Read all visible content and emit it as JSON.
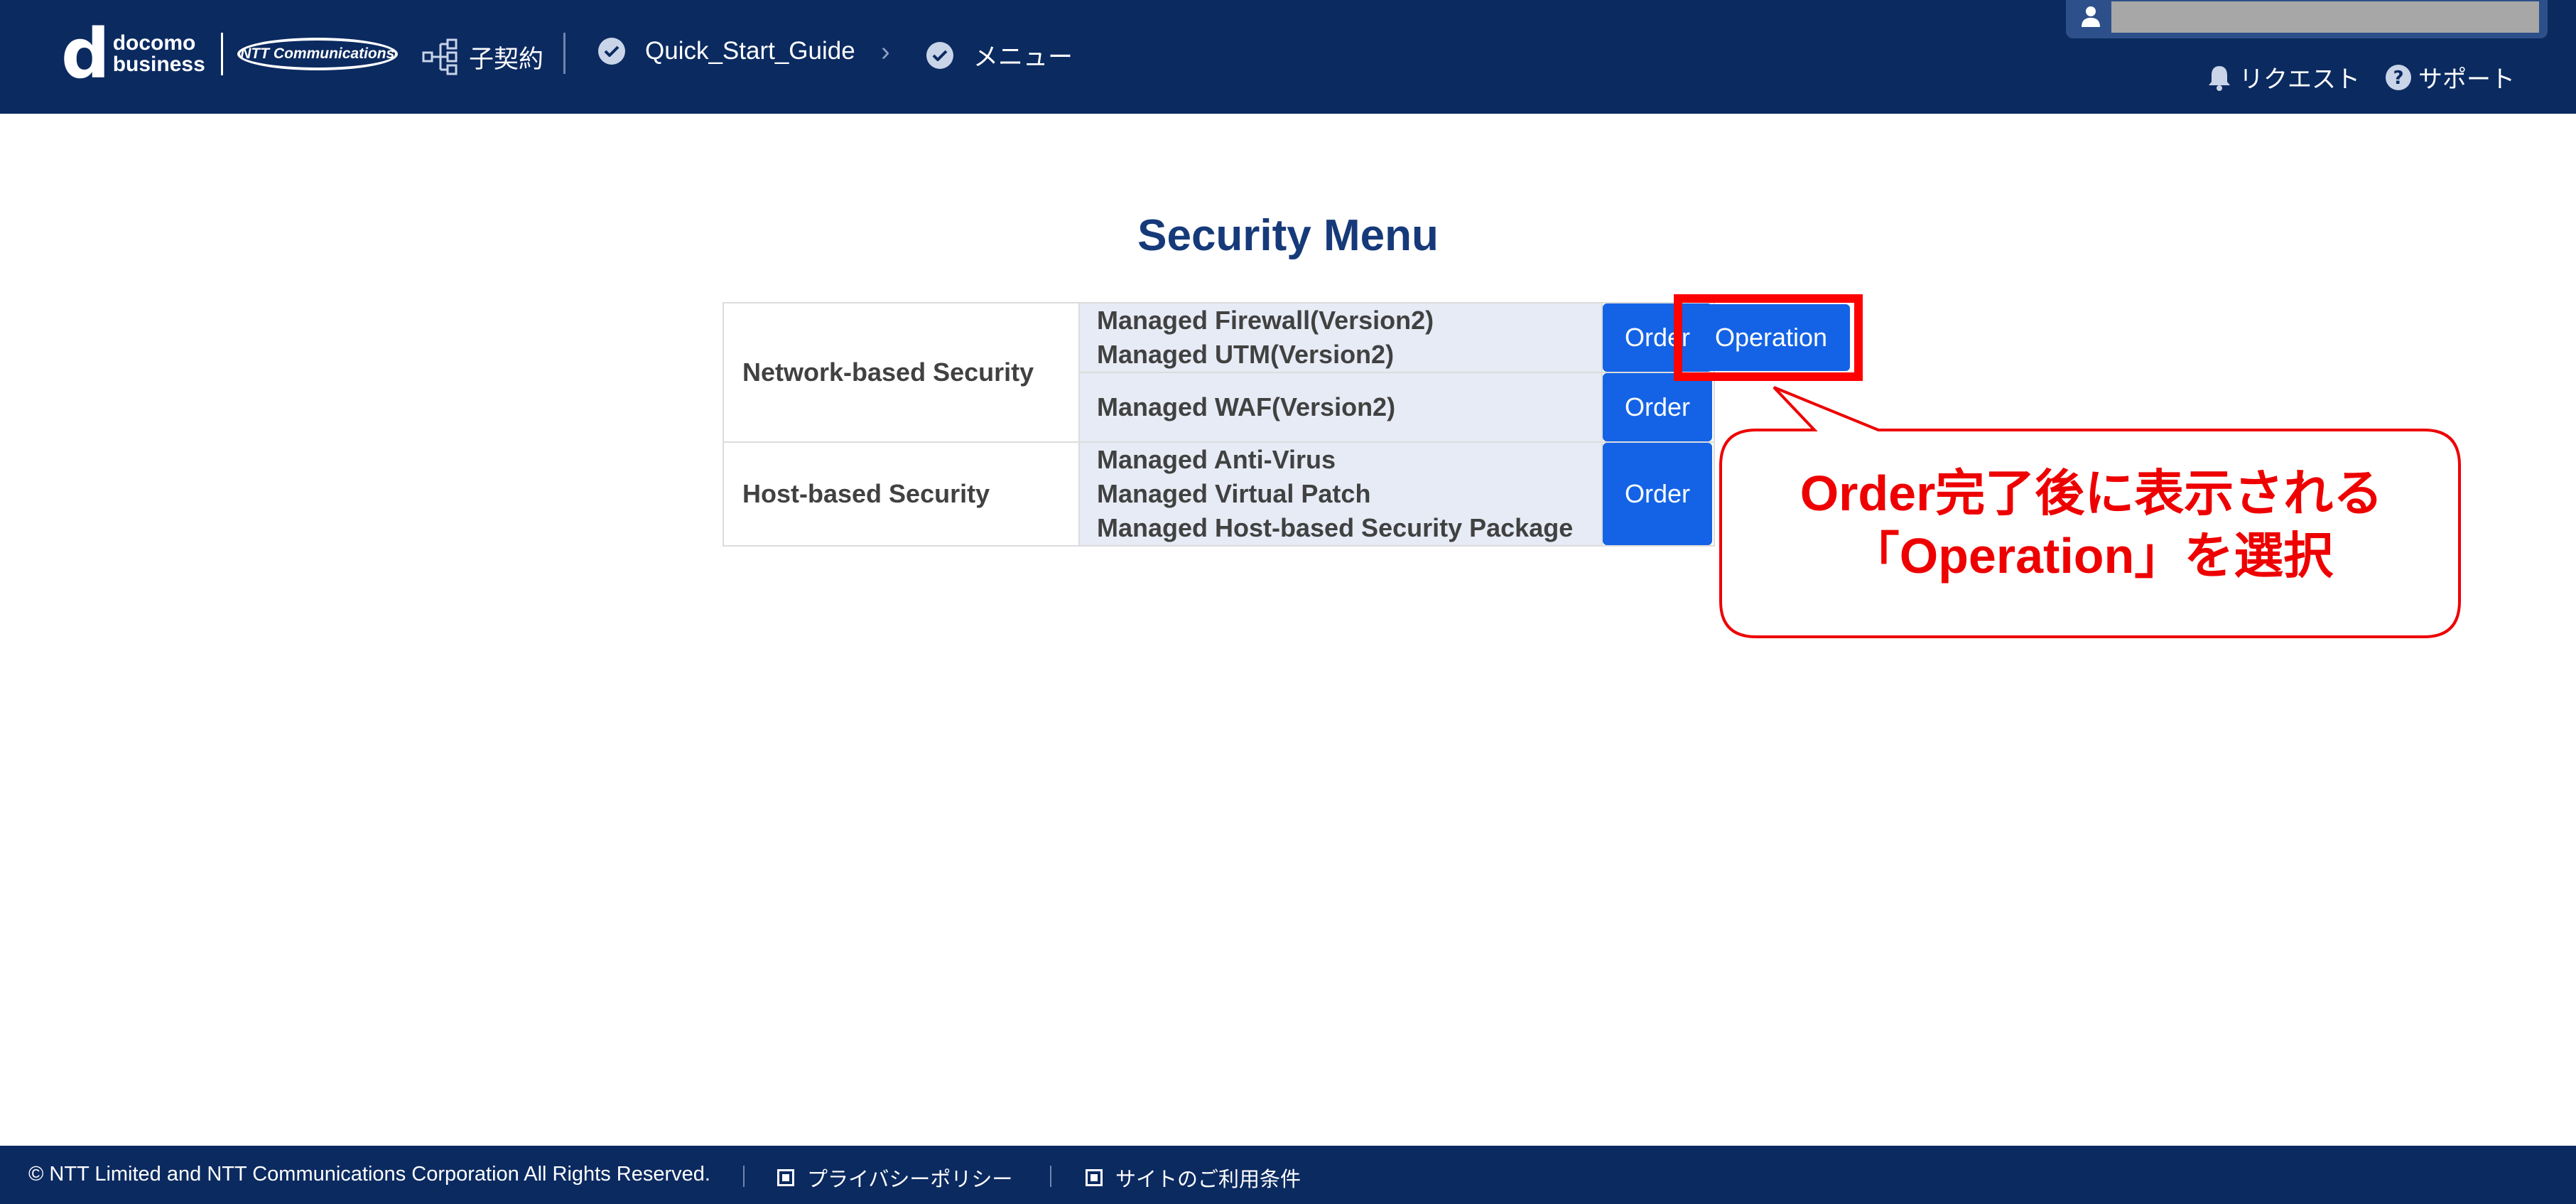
{
  "header": {
    "brand": {
      "d_glyph": "d",
      "line1": "docomo",
      "line2": "business",
      "partner": "NTT Communications"
    },
    "contract_label": "子契約",
    "breadcrumbs": [
      "Quick_Start_Guide",
      "メニュー"
    ],
    "breadcrumb_separator": "›",
    "links": {
      "request": "リクエスト",
      "support": "サポート"
    },
    "icons": [
      "tree-icon",
      "check-circle-icon",
      "user-icon",
      "bell-icon",
      "help-circle-icon"
    ]
  },
  "main": {
    "title": "Security Menu",
    "sections": [
      {
        "category": "Network-based Security",
        "rows": [
          {
            "services": [
              "Managed Firewall(Version2)",
              "Managed UTM(Version2)"
            ],
            "order_label": "Order",
            "operation_label": "Operation"
          },
          {
            "services": [
              "Managed WAF(Version2)"
            ],
            "order_label": "Order"
          }
        ]
      },
      {
        "category": "Host-based Security",
        "rows": [
          {
            "services": [
              "Managed Anti-Virus",
              "Managed Virtual Patch",
              "Managed Host-based Security Package"
            ],
            "order_label": "Order"
          }
        ]
      }
    ]
  },
  "annotation": {
    "line1": "Order完了後に表示される",
    "line2": "「Operation」を選択",
    "color": "#ee0000"
  },
  "footer": {
    "copyright": "© NTT Limited and NTT Communications Corporation All Rights Reserved.",
    "privacy": "プライバシーポリシー",
    "terms": "サイトのご利用条件"
  },
  "colors": {
    "header_bg": "#0b2a60",
    "title": "#163a79",
    "button": "#1463e6",
    "service_bg": "#e6ebf5"
  }
}
